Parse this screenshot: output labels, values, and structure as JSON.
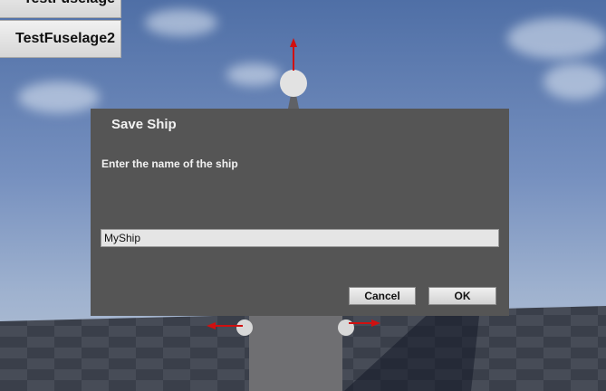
{
  "side_panel": {
    "buttons": [
      {
        "label": "TestFuselage"
      },
      {
        "label": "TestFuselage2"
      }
    ]
  },
  "dialog": {
    "title": "Save Ship",
    "prompt": "Enter the name of the ship",
    "input_value": "MyShip",
    "cancel_label": "Cancel",
    "ok_label": "OK"
  },
  "colors": {
    "dialog_background": "#555555",
    "gizmo_arrow": "#d01010",
    "sky": "#6f87b4"
  }
}
